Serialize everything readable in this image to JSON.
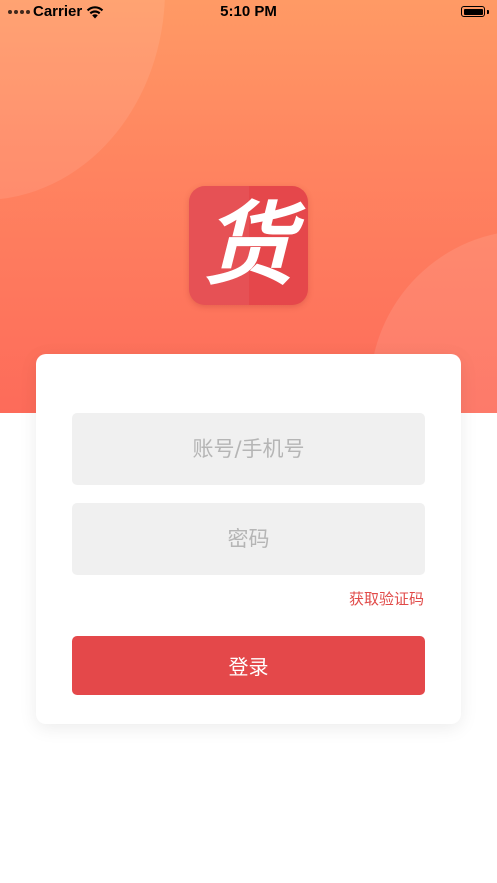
{
  "status_bar": {
    "carrier": "Carrier",
    "time": "5:10 PM",
    "wifi_icon": "wifi-icon",
    "battery_icon": "battery-icon",
    "battery_level": 1.0
  },
  "logo": {
    "glyph": "货",
    "icon": "app-logo-icon",
    "color": "#e5474b"
  },
  "colors": {
    "hero_top": "#ff9a65",
    "hero_bottom": "#fd6b5a",
    "accent": "#e4484a",
    "input_bg": "#f0f0f0"
  },
  "form": {
    "account": {
      "placeholder": "账号/手机号",
      "value": ""
    },
    "password": {
      "placeholder": "密码",
      "value": ""
    },
    "get_code_label": "获取验证码",
    "login_label": "登录"
  }
}
